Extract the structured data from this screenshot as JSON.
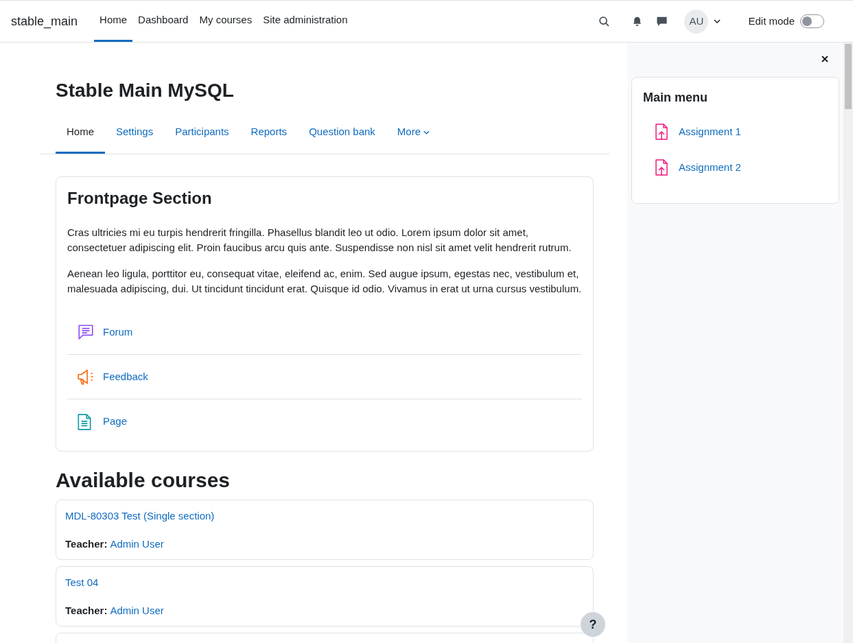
{
  "navbar": {
    "site_name": "stable_main",
    "items": [
      {
        "label": "Home",
        "selected": true
      },
      {
        "label": "Dashboard",
        "selected": false
      },
      {
        "label": "My courses",
        "selected": false
      },
      {
        "label": "Site administration",
        "selected": false
      }
    ],
    "avatar": "AU",
    "edit_mode": {
      "label": "Edit mode",
      "on": false
    }
  },
  "page_title": "Stable Main MySQL",
  "course_tabs": [
    {
      "label": "Home",
      "selected": true
    },
    {
      "label": "Settings",
      "selected": false
    },
    {
      "label": "Participants",
      "selected": false
    },
    {
      "label": "Reports",
      "selected": false
    },
    {
      "label": "Question bank",
      "selected": false
    },
    {
      "label": "More",
      "selected": false
    }
  ],
  "frontpage_section": {
    "title": "Frontpage Section",
    "paragraphs": [
      "Cras ultricies mi eu turpis hendrerit fringilla. Phasellus blandit leo ut odio. Lorem ipsum dolor sit amet, consectetuer adipiscing elit. Proin faucibus arcu quis ante. Suspendisse non nisl sit amet velit hendrerit rutrum.",
      "Aenean leo ligula, porttitor eu, consequat vitae, eleifend ac, enim. Sed augue ipsum, egestas nec, vestibulum et, malesuada adipiscing, dui. Ut tincidunt tincidunt erat. Quisque id odio. Vivamus in erat ut urna cursus vestibulum."
    ],
    "activities": [
      {
        "kind": "forum",
        "label": "Forum"
      },
      {
        "kind": "feedback",
        "label": "Feedback"
      },
      {
        "kind": "page",
        "label": "Page"
      }
    ]
  },
  "available_courses": {
    "title": "Available courses",
    "courses": [
      {
        "name": "MDL-80303 Test (Single section)",
        "teacher_label": "Teacher:",
        "teacher": "Admin User"
      },
      {
        "name": "Test 04",
        "teacher_label": "Teacher:",
        "teacher": "Admin User"
      }
    ]
  },
  "drawer": {
    "block_title": "Main menu",
    "items": [
      {
        "kind": "assign",
        "label": "Assignment 1"
      },
      {
        "kind": "assign",
        "label": "Assignment 2"
      }
    ]
  },
  "help_button": "?"
}
